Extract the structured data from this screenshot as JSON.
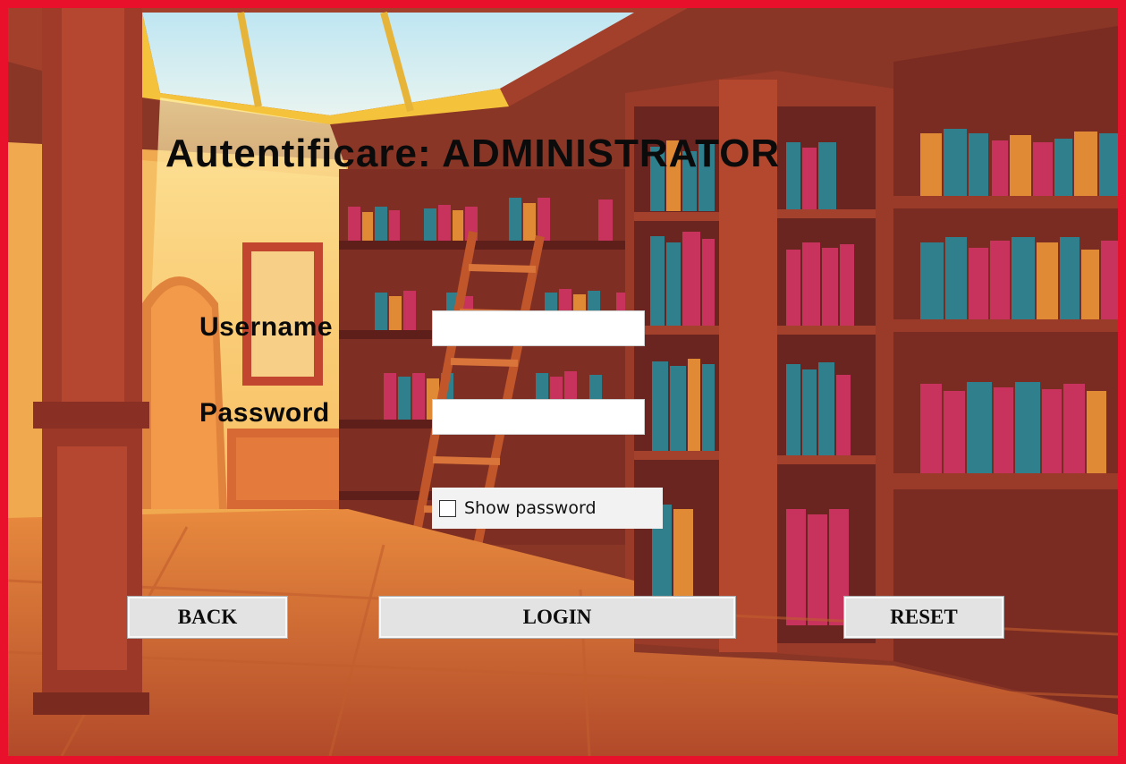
{
  "form": {
    "title": "Autentificare: ADMINISTRATOR",
    "username_label": "Username",
    "username_value": "",
    "password_label": "Password",
    "password_value": "",
    "show_password_label": "Show password",
    "show_password_checked": false
  },
  "buttons": {
    "back": "BACK",
    "login": "LOGIN",
    "reset": "RESET"
  },
  "colors": {
    "frame_border": "#e8102a",
    "button_face": "#e3e3e3",
    "input_background": "#ffffff"
  },
  "background": {
    "icon": "library-illustration"
  }
}
